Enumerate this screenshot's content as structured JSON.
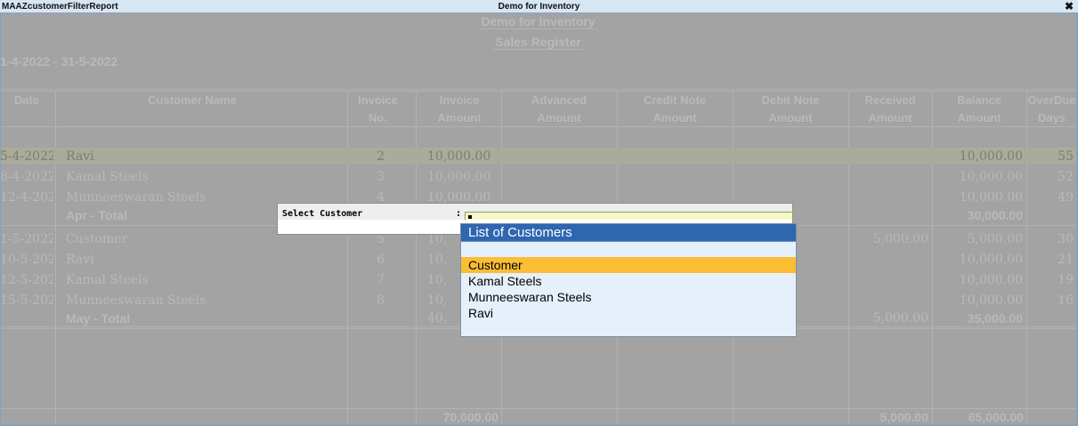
{
  "window": {
    "app_name": "MAAZcustomerFilterReport",
    "title": "Demo for Inventory",
    "close_glyph": "✖"
  },
  "report": {
    "company": "Demo for Inventory",
    "title": "Sales Register",
    "period": "1-4-2022  -  31-5-2022",
    "headers": [
      {
        "line1": "Date",
        "line2": ""
      },
      {
        "line1": "Customer Name",
        "line2": ""
      },
      {
        "line1": "Invoice",
        "line2": "No."
      },
      {
        "line1": "Invoice",
        "line2": "Amount"
      },
      {
        "line1": "Advanced",
        "line2": "Amount"
      },
      {
        "line1": "Credit Note",
        "line2": "Amount"
      },
      {
        "line1": "Debit Note",
        "line2": "Amount"
      },
      {
        "line1": "Received",
        "line2": "Amount"
      },
      {
        "line1": "Balance",
        "line2": "Amount"
      },
      {
        "line1": "OverDue",
        "line2": "Days"
      }
    ],
    "rows": [
      {
        "date": "5-4-2022",
        "customer": "Ravi",
        "invoice_no": "2",
        "invoice_amount": "10,000.00",
        "received": "",
        "balance": "10,000.00",
        "overdue": "55"
      },
      {
        "date": "8-4-2022",
        "customer": "Kamal Steels",
        "invoice_no": "3",
        "invoice_amount": "10,000.00",
        "received": "",
        "balance": "10,000.00",
        "overdue": "52"
      },
      {
        "date": "12-4-2022",
        "customer": "Munneeswaran Steels",
        "invoice_no": "4",
        "invoice_amount": "10,000.00",
        "received": "",
        "balance": "10,000.00",
        "overdue": "49"
      },
      {
        "date": "",
        "customer": "Apr - Total",
        "invoice_no": "",
        "invoice_amount": "",
        "received": "",
        "balance": "30,000.00",
        "overdue": ""
      },
      {
        "date": "1-5-2022",
        "customer": "Customer",
        "invoice_no": "5",
        "invoice_amount": "10,",
        "received": "5,000.00",
        "balance": "5,000.00",
        "overdue": "30"
      },
      {
        "date": "10-5-2022",
        "customer": "Ravi",
        "invoice_no": "6",
        "invoice_amount": "10,",
        "received": "",
        "balance": "10,000.00",
        "overdue": "21"
      },
      {
        "date": "12-5-2022",
        "customer": "Kamal Steels",
        "invoice_no": "7",
        "invoice_amount": "10,",
        "received": "",
        "balance": "10,000.00",
        "overdue": "19"
      },
      {
        "date": "15-5-2022",
        "customer": "Munneeswaran Steels",
        "invoice_no": "8",
        "invoice_amount": "10,",
        "received": "",
        "balance": "10,000.00",
        "overdue": "16"
      },
      {
        "date": "",
        "customer": "May - Total",
        "invoice_no": "",
        "invoice_amount": "40,",
        "received": "5,000.00",
        "balance": "35,000.00",
        "overdue": ""
      }
    ],
    "grand_total": {
      "invoice_amount": "70,000.00",
      "received": "5,000.00",
      "balance": "65,000.00"
    }
  },
  "dialog": {
    "label": "Select Customer",
    "colon": ":",
    "value": ""
  },
  "list": {
    "title": "List of Customers",
    "items": [
      "Customer",
      "Kamal Steels",
      "Munneeswaran Steels",
      "Ravi"
    ],
    "selected": "Customer"
  }
}
